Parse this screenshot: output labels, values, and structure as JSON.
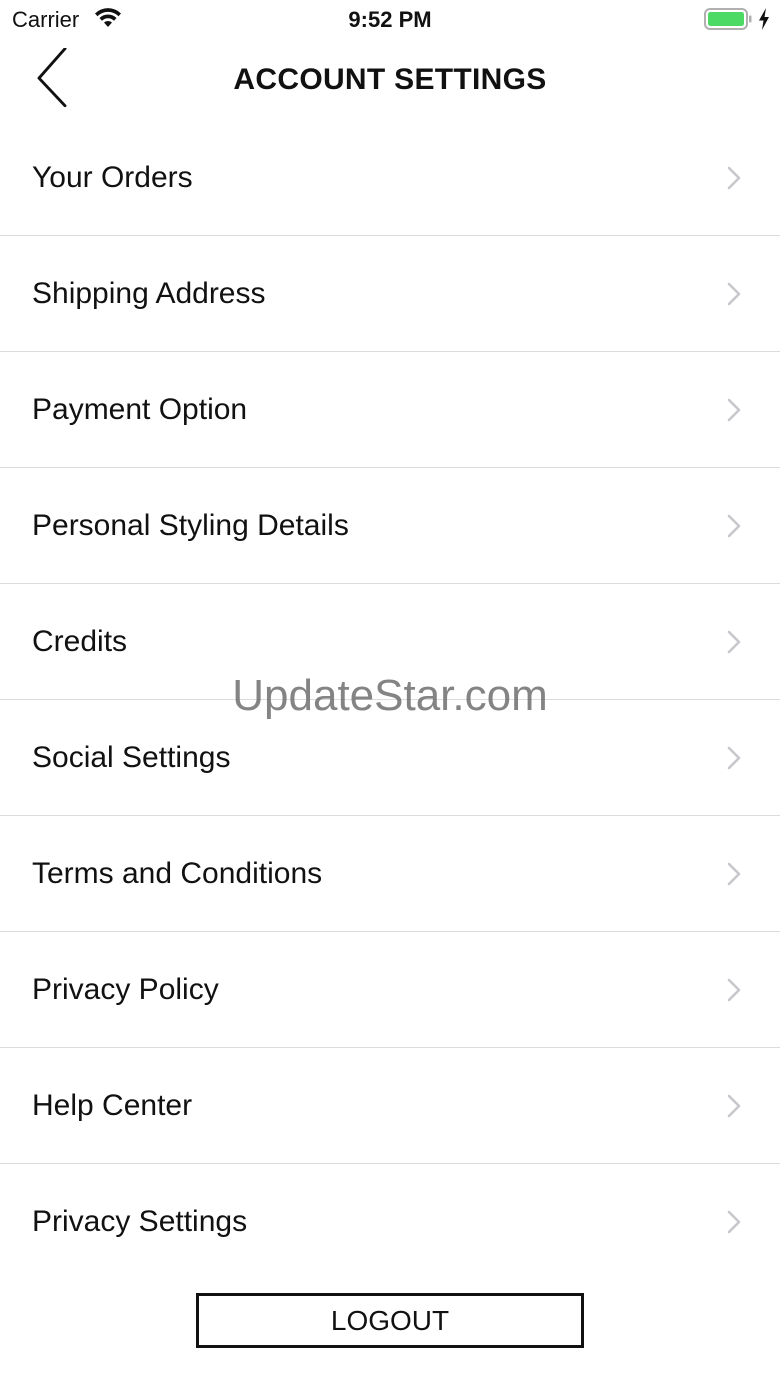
{
  "status_bar": {
    "carrier": "Carrier",
    "time": "9:52 PM",
    "battery_color": "#4cd964"
  },
  "nav": {
    "title": "ACCOUNT SETTINGS",
    "back_icon": "chevron-left-icon"
  },
  "settings": {
    "items": [
      {
        "label": "Your Orders"
      },
      {
        "label": "Shipping Address"
      },
      {
        "label": "Payment Option"
      },
      {
        "label": "Personal Styling Details"
      },
      {
        "label": "Credits"
      },
      {
        "label": "Social Settings"
      },
      {
        "label": "Terms and Conditions"
      },
      {
        "label": "Privacy Policy"
      },
      {
        "label": "Help Center"
      },
      {
        "label": "Privacy Settings"
      }
    ],
    "chevron_icon": "chevron-right-icon",
    "chevron_color": "#c7c7cc",
    "divider_color": "#dcdcdc"
  },
  "watermark": "UpdateStar.com",
  "logout": {
    "label": "LOGOUT"
  }
}
